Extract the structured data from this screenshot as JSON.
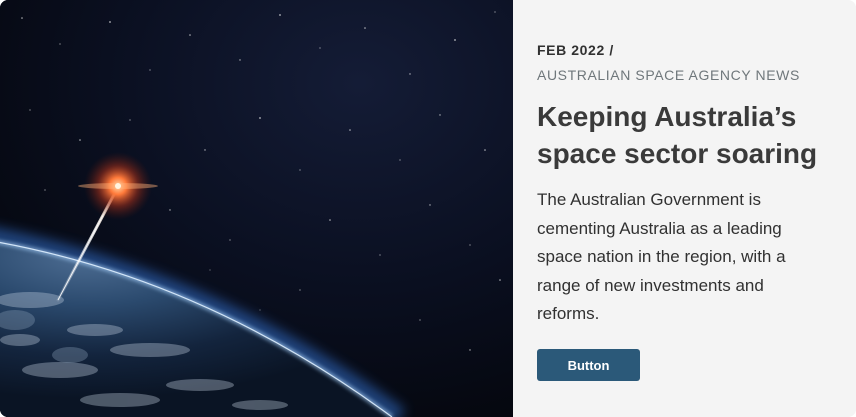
{
  "card": {
    "image": {
      "alt_icon": "earth-launch-image"
    },
    "meta": {
      "date": "FEB 2022 /",
      "source": "AUSTRALIAN SPACE AGENCY NEWS"
    },
    "title": "Keeping Australia’s space sector soaring",
    "description": "The Australian Government is cementing Australia as a leading space nation in the region, with a range of new investments and reforms.",
    "button_label": "Button",
    "colors": {
      "button_bg": "#2b5979",
      "panel_bg": "#f4f4f4",
      "title": "#3a3a3a",
      "source": "#6f777b"
    }
  }
}
